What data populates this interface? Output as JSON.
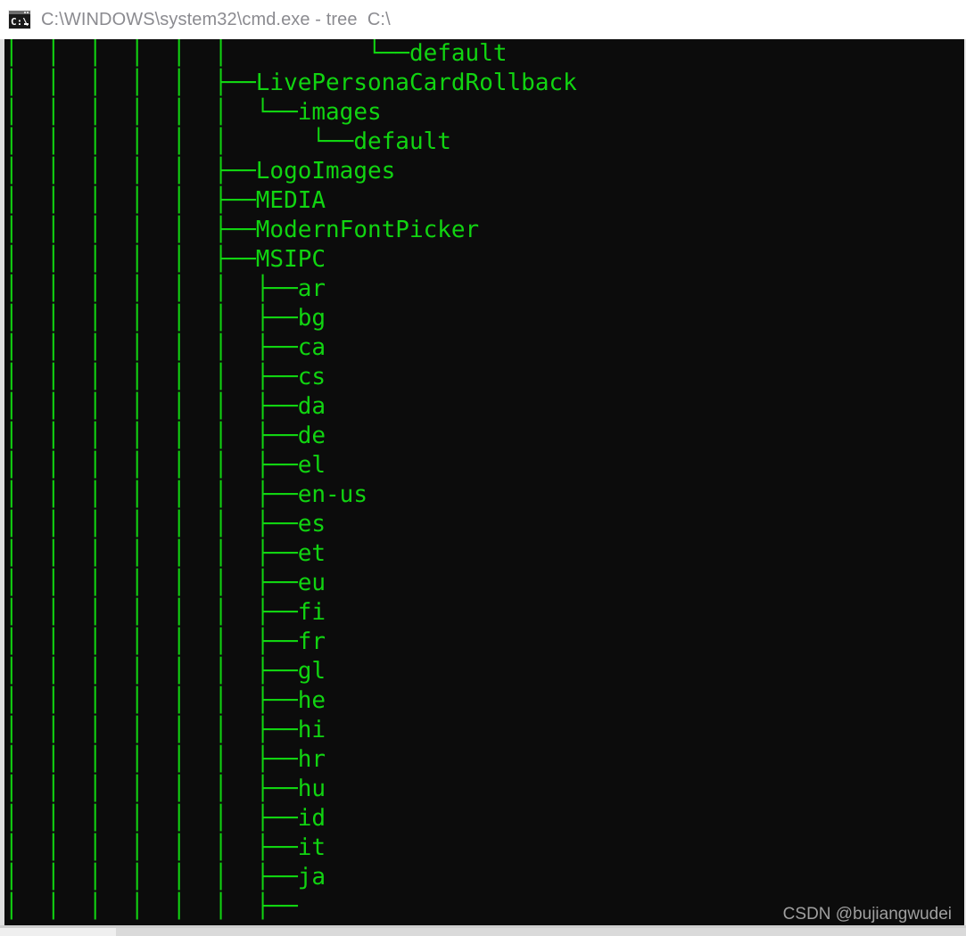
{
  "window": {
    "title": "C:\\WINDOWS\\system32\\cmd.exe - tree  C:\\",
    "icon_name": "cmd-exe-icon",
    "icon_text": "C:\\_",
    "background_color": "#0c0c0c",
    "text_color": "#11d411",
    "titlebar_text_color": "#8b8b90"
  },
  "command": {
    "program": "tree",
    "argument": "C:\\"
  },
  "watermark": {
    "text": "CSDN @bujiangwudei"
  },
  "tree": {
    "ascii": "│  │  │  │  │  │          └──default\n│  │  │  │  │  ├──LivePersonaCardRollback\n│  │  │  │  │  │  └──images\n│  │  │  │  │  │      └──default\n│  │  │  │  │  ├──LogoImages\n│  │  │  │  │  ├──MEDIA\n│  │  │  │  │  ├──ModernFontPicker\n│  │  │  │  │  ├──MSIPC\n│  │  │  │  │  │  ├──ar\n│  │  │  │  │  │  ├──bg\n│  │  │  │  │  │  ├──ca\n│  │  │  │  │  │  ├──cs\n│  │  │  │  │  │  ├──da\n│  │  │  │  │  │  ├──de\n│  │  │  │  │  │  ├──el\n│  │  │  │  │  │  ├──en-us\n│  │  │  │  │  │  ├──es\n│  │  │  │  │  │  ├──et\n│  │  │  │  │  │  ├──eu\n│  │  │  │  │  │  ├──fi\n│  │  │  │  │  │  ├──fr\n│  │  │  │  │  │  ├──gl\n│  │  │  │  │  │  ├──he\n│  │  │  │  │  │  ├──hi\n│  │  │  │  │  │  ├──hr\n│  │  │  │  │  │  ├──hu\n│  │  │  │  │  │  ├──id\n│  │  │  │  │  │  ├──it\n│  │  │  │  │  │  ├──ja\n│  │  │  │  │  │  ├──",
    "lines": [
      {
        "prefix": "│  │  │  │  │  │          └──",
        "label": "default"
      },
      {
        "prefix": "│  │  │  │  │  ├──",
        "label": "LivePersonaCardRollback"
      },
      {
        "prefix": "│  │  │  │  │  │  └──",
        "label": "images"
      },
      {
        "prefix": "│  │  │  │  │  │      └──",
        "label": "default"
      },
      {
        "prefix": "│  │  │  │  │  ├──",
        "label": "LogoImages"
      },
      {
        "prefix": "│  │  │  │  │  ├──",
        "label": "MEDIA"
      },
      {
        "prefix": "│  │  │  │  │  ├──",
        "label": "ModernFontPicker"
      },
      {
        "prefix": "│  │  │  │  │  ├──",
        "label": "MSIPC"
      },
      {
        "prefix": "│  │  │  │  │  │  ├──",
        "label": "ar"
      },
      {
        "prefix": "│  │  │  │  │  │  ├──",
        "label": "bg"
      },
      {
        "prefix": "│  │  │  │  │  │  ├──",
        "label": "ca"
      },
      {
        "prefix": "│  │  │  │  │  │  ├──",
        "label": "cs"
      },
      {
        "prefix": "│  │  │  │  │  │  ├──",
        "label": "da"
      },
      {
        "prefix": "│  │  │  │  │  │  ├──",
        "label": "de"
      },
      {
        "prefix": "│  │  │  │  │  │  ├──",
        "label": "el"
      },
      {
        "prefix": "│  │  │  │  │  │  ├──",
        "label": "en-us"
      },
      {
        "prefix": "│  │  │  │  │  │  ├──",
        "label": "es"
      },
      {
        "prefix": "│  │  │  │  │  │  ├──",
        "label": "et"
      },
      {
        "prefix": "│  │  │  │  │  │  ├──",
        "label": "eu"
      },
      {
        "prefix": "│  │  │  │  │  │  ├──",
        "label": "fi"
      },
      {
        "prefix": "│  │  │  │  │  │  ├──",
        "label": "fr"
      },
      {
        "prefix": "│  │  │  │  │  │  ├──",
        "label": "gl"
      },
      {
        "prefix": "│  │  │  │  │  │  ├──",
        "label": "he"
      },
      {
        "prefix": "│  │  │  │  │  │  ├──",
        "label": "hi"
      },
      {
        "prefix": "│  │  │  │  │  │  ├──",
        "label": "hr"
      },
      {
        "prefix": "│  │  │  │  │  │  ├──",
        "label": "hu"
      },
      {
        "prefix": "│  │  │  │  │  │  ├──",
        "label": "id"
      },
      {
        "prefix": "│  │  │  │  │  │  ├──",
        "label": "it"
      },
      {
        "prefix": "│  │  │  │  │  │  ├──",
        "label": "ja"
      },
      {
        "prefix": "│  │  │  │  │  │  ├──",
        "label": ""
      }
    ]
  }
}
